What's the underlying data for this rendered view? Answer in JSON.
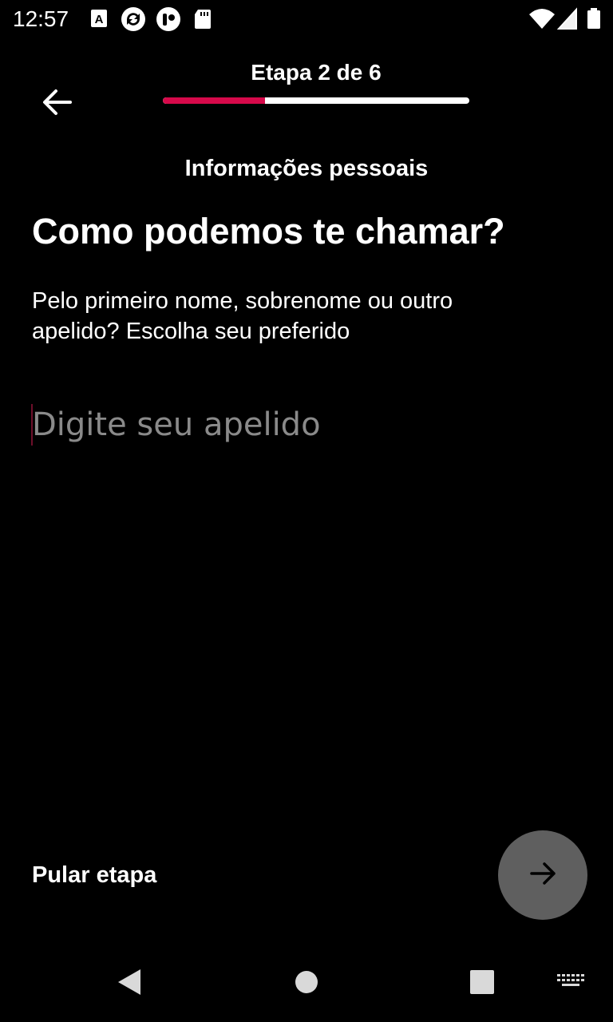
{
  "status_bar": {
    "time": "12:57",
    "left_icons": [
      "text-a-icon",
      "sync-icon",
      "pocket-icon",
      "sd-card-icon"
    ],
    "right_icons": [
      "wifi-icon",
      "cell-signal-icon",
      "battery-icon"
    ]
  },
  "header": {
    "back_icon": "arrow-left-icon",
    "step_label": "Etapa 2 de 6",
    "progress": {
      "current_step": 2,
      "total_steps": 6,
      "fill_fraction": 0.333,
      "fill_color": "#d6094a",
      "track_color": "#ffffff"
    }
  },
  "content": {
    "section_title": "Informações pessoais",
    "title": "Como podemos te chamar?",
    "subtitle": "Pelo primeiro nome, sobrenome ou outro apelido? Escolha seu preferido",
    "nickname_input": {
      "value": "",
      "placeholder": "Digite seu apelido"
    }
  },
  "footer": {
    "skip_label": "Pular etapa",
    "next_icon": "arrow-right-icon"
  },
  "nav_bar": {
    "icons": [
      "back-triangle-icon",
      "home-circle-icon",
      "recents-square-icon",
      "keyboard-icon"
    ]
  },
  "colors": {
    "background": "#000000",
    "accent": "#d6094a",
    "next_button": "#5f5f5f",
    "placeholder": "#8a8a8a"
  }
}
